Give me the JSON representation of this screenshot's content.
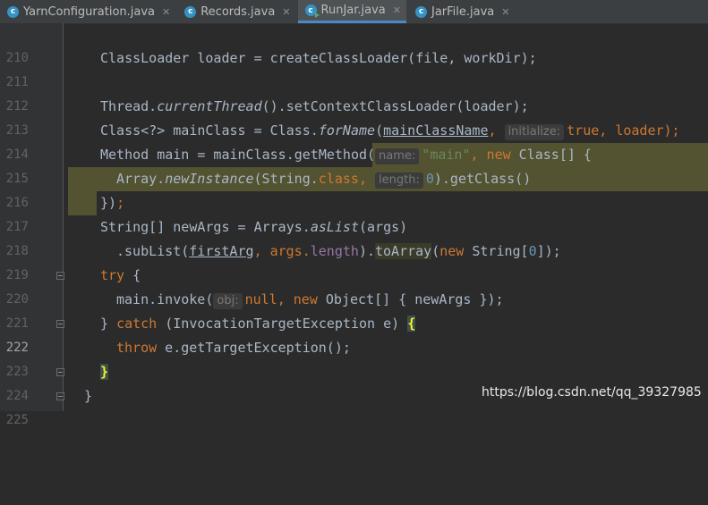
{
  "tabs": [
    {
      "label": "YarnConfiguration.java",
      "icon": "java-class-icon",
      "active": false
    },
    {
      "label": "Records.java",
      "icon": "java-class-icon",
      "active": false
    },
    {
      "label": "RunJar.java",
      "icon": "java-runnable-class-icon",
      "active": true
    },
    {
      "label": "JarFile.java",
      "icon": "java-class-icon",
      "active": false
    }
  ],
  "close_glyph": "✕",
  "line_numbers": [
    "210",
    "211",
    "212",
    "213",
    "214",
    "215",
    "216",
    "217",
    "218",
    "219",
    "220",
    "221",
    "222",
    "223",
    "224",
    "225"
  ],
  "current_line": "222",
  "code": {
    "l211": "ClassLoader loader = createClassLoader(file, workDir);",
    "l213a": "Thread.",
    "l213b": "currentThread",
    "l213c": "().setContextClassLoader(loader);",
    "l214a": "Class<?> mainClass = Class.",
    "l214b": "forName",
    "l214c": "(",
    "l214d": "mainClassName",
    "l214e": ", ",
    "l214hint": "initialize:",
    "l214f": "true",
    "l214g": ", loader);",
    "l215a": "Method main = mainClass.getMethod(",
    "l215hint": "name:",
    "l215b": "\"main\"",
    "l215c": ", ",
    "l215d": "new",
    "l215e": " Class[] {",
    "l216a": "Array.",
    "l216b": "newInstance",
    "l216c": "(String.",
    "l216d": "class",
    "l216e": ", ",
    "l216hint": "length:",
    "l216f": "0",
    "l216g": ").getClass()",
    "l217a": "})",
    "l217b": ";",
    "l218a": "String[] newArgs = Arrays.",
    "l218b": "asList",
    "l218c": "(args)",
    "l219a": ".subList(",
    "l219b": "firstArg",
    "l219c": ", args.",
    "l219d": "length",
    "l219e": ").",
    "l219f": "toArray",
    "l219g": "(",
    "l219h": "new",
    "l219i": " String[",
    "l219j": "0",
    "l219k": "]);",
    "l220a": "try",
    "l220b": " {",
    "l221a": "main.invoke(",
    "l221hint": "obj:",
    "l221b": "null",
    "l221c": ", ",
    "l221d": "new",
    "l221e": " Object[] { newArgs });",
    "l222a": "} ",
    "l222b": "catch",
    "l222c": " (InvocationTargetException e) ",
    "l222d": "{",
    "l223a": "throw",
    "l223b": " e.getTargetException();",
    "l224a": "}",
    "l225a": "}"
  },
  "watermark": "https://blog.csdn.net/qq_39327985"
}
